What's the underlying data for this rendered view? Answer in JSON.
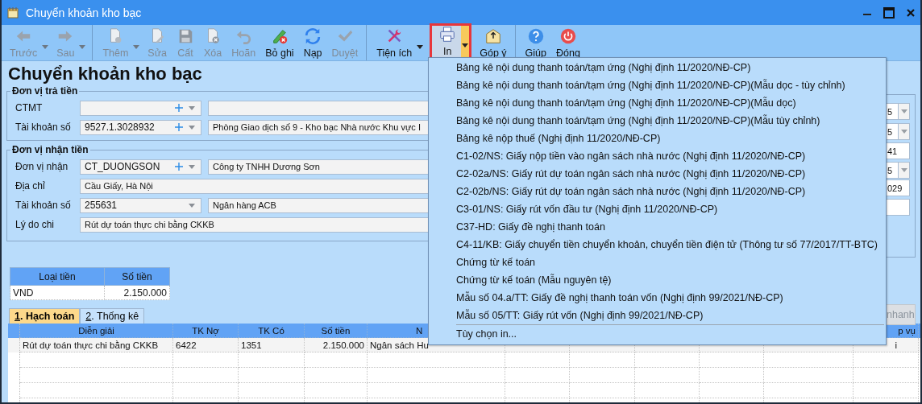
{
  "window": {
    "title": "Chuyển khoản kho bạc"
  },
  "toolbar": [
    {
      "label": "Trước",
      "disabled": true,
      "dropdown": true,
      "separator_after": false
    },
    {
      "label": "Sau",
      "disabled": true,
      "dropdown": true,
      "separator_after": true
    },
    {
      "label": "Thêm",
      "disabled": true,
      "dropdown": true,
      "separator_after": false
    },
    {
      "label": "Sửa",
      "disabled": true,
      "dropdown": false,
      "separator_after": false
    },
    {
      "label": "Cất",
      "disabled": true,
      "dropdown": false,
      "separator_after": false
    },
    {
      "label": "Xóa",
      "disabled": true,
      "dropdown": false,
      "separator_after": false
    },
    {
      "label": "Hoãn",
      "disabled": true,
      "dropdown": false,
      "separator_after": false
    },
    {
      "label": "Bỏ ghi",
      "disabled": false,
      "dropdown": false,
      "separator_after": false
    },
    {
      "label": "Nạp",
      "disabled": false,
      "dropdown": false,
      "separator_after": false
    },
    {
      "label": "Duyệt",
      "disabled": true,
      "dropdown": false,
      "separator_after": true
    },
    {
      "label": "Tiện ích",
      "disabled": false,
      "dropdown": true,
      "separator_after": false
    },
    {
      "label": "In",
      "disabled": false,
      "dropdown": true,
      "separator_after": false,
      "highlighted": true
    },
    {
      "label": "Góp ý",
      "disabled": false,
      "dropdown": false,
      "separator_after": true
    },
    {
      "label": "Giúp",
      "disabled": false,
      "dropdown": false,
      "separator_after": false
    },
    {
      "label": "Đóng",
      "disabled": false,
      "dropdown": false,
      "separator_after": false
    }
  ],
  "page_title": "Chuyển khoản kho bạc",
  "payer": {
    "legend": "Đơn vị trả tiền",
    "rows": [
      {
        "label": "CTMT",
        "kind": "combo",
        "code": "",
        "has_add": true,
        "name": ""
      },
      {
        "label": "Tài khoản số",
        "kind": "combo",
        "code": "9527.1.3028932",
        "has_add": true,
        "name": "Phòng Giao dịch số 9 - Kho bạc Nhà nước Khu vực I"
      }
    ]
  },
  "payee": {
    "legend": "Đơn vị nhận tiền",
    "rows": [
      {
        "label": "Đơn vị nhận",
        "kind": "combo",
        "code": "CT_DUONGSON",
        "has_add": true,
        "name": "Công ty TNHH Dương Sơn"
      },
      {
        "label": "Địa chỉ",
        "kind": "wide",
        "value": "Cầu Giấy, Hà Nội"
      },
      {
        "label": "Tài khoản số",
        "kind": "combo",
        "code": "255631",
        "has_add": false,
        "name": "Ngân hàng ACB"
      },
      {
        "label": "Lý do chi",
        "kind": "wide",
        "value": "Rút dự toán thực chi bằng CKKB"
      }
    ]
  },
  "side_fields": [
    {
      "kind": "dropdown",
      "value": "5"
    },
    {
      "kind": "dropdown",
      "value": "5"
    },
    {
      "kind": "text",
      "value": "41"
    },
    {
      "kind": "dropdown",
      "value": "5"
    },
    {
      "kind": "text",
      "value": "029"
    },
    {
      "kind": "text"
    }
  ],
  "currency_table": {
    "columns": [
      "Loại tiền",
      "Số tiền"
    ],
    "rows": [
      [
        "VND",
        "2.150.000"
      ]
    ]
  },
  "tabs": [
    {
      "label": "1. Hạch toán",
      "selected": true
    },
    {
      "label": "2. Thống kê",
      "selected": false
    }
  ],
  "quick_button": "nhanh",
  "grid": {
    "columns": [
      "Diễn giải",
      "TK Nợ",
      "TK Có",
      "Số tiền",
      "N",
      "p vụ"
    ],
    "rows": [
      [
        "Rút dự toán thực chi bằng CKKB",
        "6422",
        "1351",
        "2.150.000",
        "Ngân sách Hu",
        "i"
      ]
    ]
  },
  "print_menu": {
    "items": [
      "Bảng kê nội dung thanh toán/tạm ứng (Nghị định 11/2020/NĐ-CP)",
      "Bảng kê nội dung thanh toán/tạm ứng (Nghị định 11/2020/NĐ-CP)(Mẫu dọc - tùy chỉnh)",
      "Bảng kê nội dung thanh toán/tạm ứng (Nghị định 11/2020/NĐ-CP)(Mẫu dọc)",
      "Bảng kê nội dung thanh toán/tạm ứng (Nghị định 11/2020/NĐ-CP)(Mẫu tùy chỉnh)",
      "Bảng kê nộp thuế (Nghị định 11/2020/NĐ-CP)",
      "C1-02/NS: Giấy nộp tiền vào ngân sách nhà nước (Nghị định 11/2020/NĐ-CP)",
      "C2-02a/NS: Giấy rút dự toán ngân sách nhà nước (Nghị định 11/2020/NĐ-CP)",
      "C2-02b/NS: Giấy rút dự toán ngân sách nhà nước (Nghị định 11/2020/NĐ-CP)",
      "C3-01/NS: Giấy rút vốn đầu tư (Nghị định 11/2020/NĐ-CP)",
      "C37-HD: Giấy đề nghị thanh toán",
      "C4-11/KB: Giấy chuyển tiền chuyển khoản, chuyển tiền điện tử (Thông tư số 77/2017/TT-BTC)",
      "Chứng từ kế toán",
      "Chứng từ kế toán (Mẫu nguyên tệ)",
      "Mẫu số 04.a/TT: Giấy đề nghị thanh toán vốn (Nghị định 99/2021/NĐ-CP)",
      "Mẫu số 05/TT: Giấy rút vốn (Nghị định 99/2021/NĐ-CP)"
    ],
    "footer_item": "Tùy chọn in..."
  }
}
